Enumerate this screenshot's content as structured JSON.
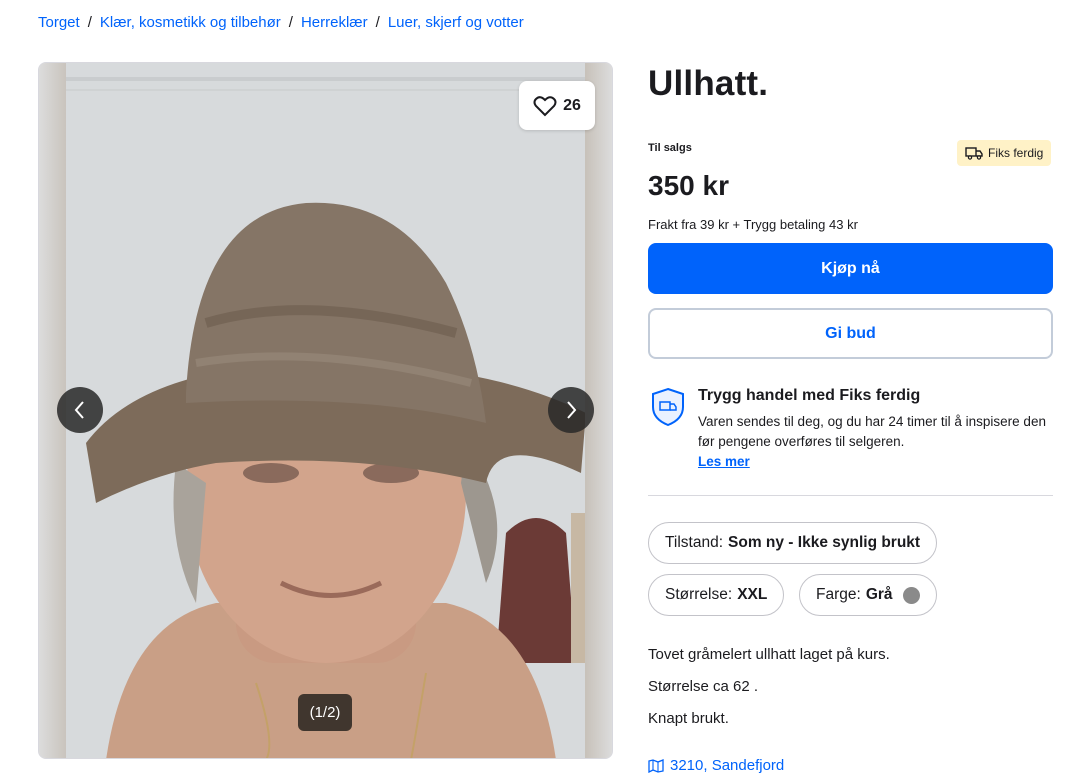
{
  "breadcrumb": [
    "Torget",
    "Klær, kosmetikk og tilbehør",
    "Herreklær",
    "Luer, skjerf og votter"
  ],
  "gallery": {
    "favorites": "26",
    "counter": "(1/2)"
  },
  "listing": {
    "title": "Ullhatt.",
    "status": "Til salgs",
    "badge": "Fiks ferdig",
    "price": "350 kr",
    "shipping": "Frakt fra 39 kr + Trygg betaling 43 kr",
    "buy_label": "Kjøp nå",
    "bid_label": "Gi bud"
  },
  "safe_trade": {
    "heading": "Trygg handel med Fiks ferdig",
    "text": "Varen sendes til deg, og du har 24 timer til å inspisere den før pengene overføres til selgeren.",
    "link": "Les mer"
  },
  "attributes": {
    "condition_label": "Tilstand:",
    "condition_value": "Som ny - Ikke synlig brukt",
    "size_label": "Størrelse:",
    "size_value": "XXL",
    "color_label": "Farge:",
    "color_value": "Grå",
    "color_hex": "#8a8a8a"
  },
  "description": [
    "Tovet gråmelert ullhatt laget på kurs.",
    "Størrelse ca 62 .",
    "Knapt brukt."
  ],
  "location": "3210, Sandefjord",
  "colors": {
    "accent": "#0063fb",
    "badge_bg": "#fff2c7"
  }
}
